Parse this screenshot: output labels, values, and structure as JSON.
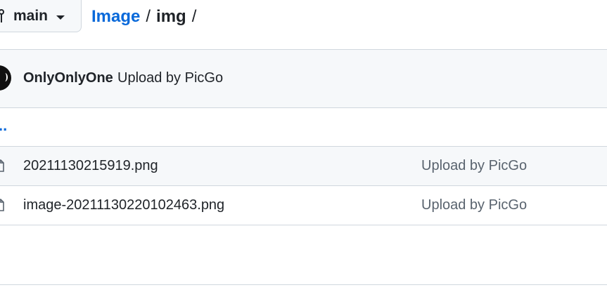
{
  "branch": {
    "name": "main",
    "icon": "git-branch-icon",
    "dropdown_icon": "caret-down-icon"
  },
  "breadcrumb": {
    "repo_link": "Image",
    "separator_1": "/",
    "current_folder": "img",
    "separator_2": "/"
  },
  "commit": {
    "author": "OnlyOnlyOne",
    "message": "Upload by PicGo",
    "avatar_icon": "avatar"
  },
  "parent_dir": {
    "label": ".."
  },
  "files": [
    {
      "name": "20211130215919.png",
      "commit_message": "Upload by PicGo",
      "icon": "file-icon"
    },
    {
      "name": "image-20211130220102463.png",
      "commit_message": "Upload by PicGo",
      "icon": "file-icon"
    }
  ],
  "colors": {
    "link": "#0969da",
    "text": "#1f2328",
    "muted": "#59636e",
    "border": "#d0d7de",
    "row_bg": "#f6f8fa"
  }
}
